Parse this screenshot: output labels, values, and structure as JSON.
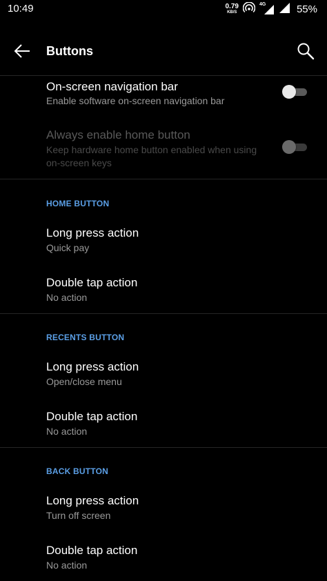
{
  "status_bar": {
    "time": "10:49",
    "net_speed_value": "0.79",
    "net_speed_unit": "KB/S",
    "network_type": "4G",
    "battery": "55%"
  },
  "toolbar": {
    "title": "Buttons"
  },
  "top_settings": [
    {
      "title": "On-screen navigation bar",
      "subtitle": "Enable software on-screen navigation bar",
      "toggle": "off",
      "enabled": true
    },
    {
      "title": "Always enable home button",
      "subtitle": "Keep hardware home button enabled when using on-screen keys",
      "toggle": "off",
      "enabled": false
    }
  ],
  "sections": [
    {
      "header": "HOME BUTTON",
      "items": [
        {
          "title": "Long press action",
          "subtitle": "Quick pay"
        },
        {
          "title": "Double tap action",
          "subtitle": "No action"
        }
      ]
    },
    {
      "header": "RECENTS BUTTON",
      "items": [
        {
          "title": "Long press action",
          "subtitle": "Open/close menu"
        },
        {
          "title": "Double tap action",
          "subtitle": "No action"
        }
      ]
    },
    {
      "header": "BACK BUTTON",
      "items": [
        {
          "title": "Long press action",
          "subtitle": "Turn off screen"
        },
        {
          "title": "Double tap action",
          "subtitle": "No action"
        }
      ]
    }
  ],
  "colors": {
    "background": "#000000",
    "accent": "#5b9fe6",
    "secondary_text": "#9a9a9a"
  }
}
